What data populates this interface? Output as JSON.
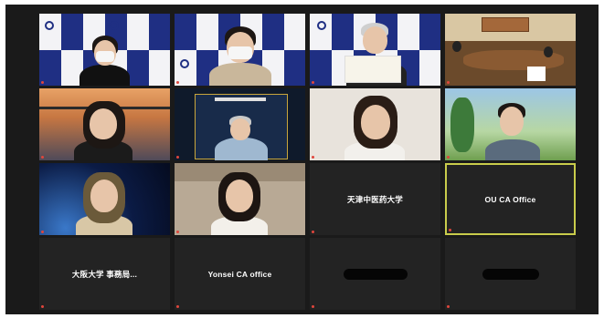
{
  "window": {
    "title": ""
  },
  "tiles": [
    {
      "id": "t1",
      "caption": "",
      "active": false
    },
    {
      "id": "t2",
      "caption": "",
      "active": false
    },
    {
      "id": "t3",
      "caption": "",
      "active": false
    },
    {
      "id": "t4",
      "caption": "",
      "active": false
    },
    {
      "id": "t5",
      "caption": "",
      "active": false
    },
    {
      "id": "t6",
      "caption": "",
      "active": false
    },
    {
      "id": "t7",
      "caption": "",
      "active": false
    },
    {
      "id": "t8",
      "caption": "",
      "active": false
    },
    {
      "id": "t9",
      "caption": "",
      "active": false
    },
    {
      "id": "t10",
      "caption": "",
      "active": false
    },
    {
      "id": "t11",
      "name": "天津中医药大学",
      "active": false
    },
    {
      "id": "t12",
      "name": "OU CA Office",
      "active": true
    },
    {
      "id": "t13",
      "name": "大阪大学 事務局...",
      "active": false
    },
    {
      "id": "t14",
      "name": "Yonsei CA office",
      "active": false
    },
    {
      "id": "t15",
      "name": "",
      "active": false,
      "redacted": true
    },
    {
      "id": "t16",
      "name": "",
      "active": false,
      "redacted": true
    }
  ],
  "colors": {
    "active_border": "#c9cc4b",
    "backdrop_navy": "#1f2f83",
    "tile_bg": "#232323",
    "window_bg": "#1a1a1a",
    "muted_mic": "#e0463c"
  },
  "icons": {
    "mic": "muted-mic-icon",
    "university_logo": "university-logo-icon"
  }
}
